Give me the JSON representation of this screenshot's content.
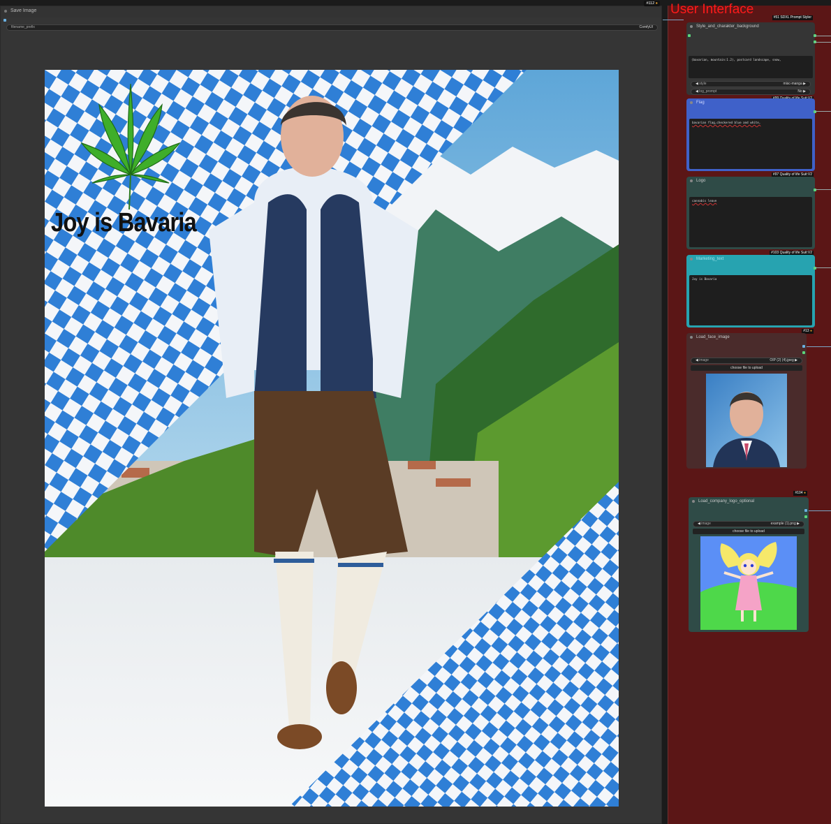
{
  "save_image": {
    "title": "Save Image",
    "node_badge": "#112",
    "filename_label": "filename_prefix",
    "filename_value": "ComfyUI"
  },
  "generated_image": {
    "overlay_text": "Joy is Bavaria",
    "colors": {
      "checker_blue": "#2f7fd6",
      "checker_white": "#f4f6f9",
      "leaf_green": "#3fae2a",
      "vest": "#263a60"
    }
  },
  "group": {
    "title": "User Interface",
    "color": "#5b1616",
    "title_color": "#ff1a1a"
  },
  "style_node": {
    "badge": "#51 SDXL Prompt Styler",
    "title": "Style_and_charakter_background",
    "prompt_text": "(bavarian, mountain:1.2), postcard landscape, snow,",
    "style_label": "style",
    "style_value": "misc-manga",
    "log_label": "log_prompt",
    "log_value": "No",
    "footer_label": "#99 Quality of life Suit:V2"
  },
  "flag_node": {
    "title": "Flag",
    "prompt_text": "bavarian flag,checkered blue and white,",
    "footer_label": "#97 Quality of life Suit:V2"
  },
  "logo_node": {
    "title": "Logo",
    "prompt_text": "cannabis leave",
    "footer_label": "#103 Quality of life Suit:V2"
  },
  "marketing_node": {
    "title": "Marketing_text",
    "prompt_text": "Joy is Bavaria",
    "footer_label": "#13"
  },
  "face_node": {
    "title": "Load_face_image",
    "image_label": "image",
    "image_value": "OIP (2) (4).jpeg",
    "upload_label": "choose file to upload"
  },
  "company_logo_node": {
    "badge": "#104",
    "title": "Load_company_logo_optional",
    "image_label": "image",
    "image_value": "example (1).png",
    "upload_label": "choose file to upload"
  }
}
